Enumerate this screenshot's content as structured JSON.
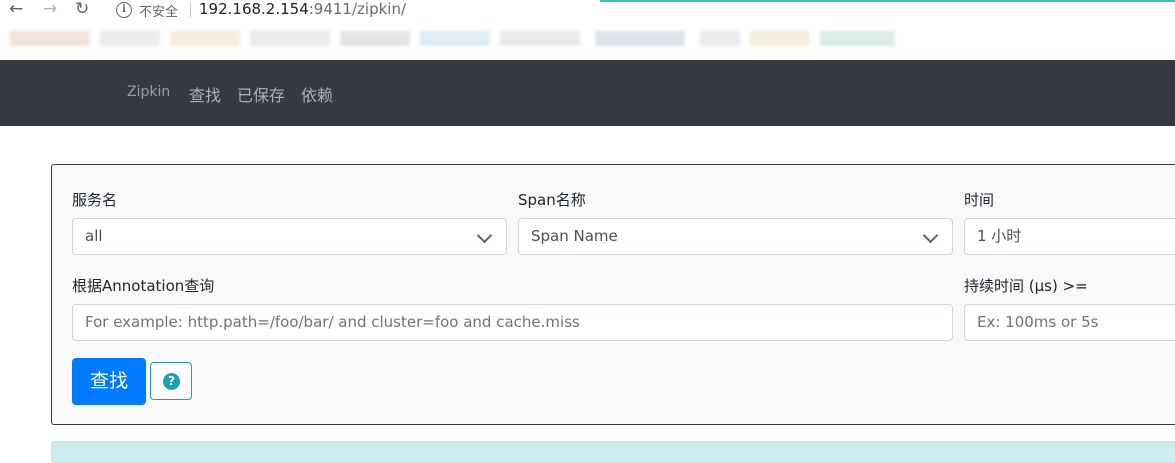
{
  "browser": {
    "security_label": "不安全",
    "url_host": "192.168.2.154",
    "url_path": ":9411/zipkin/"
  },
  "navbar": {
    "brand": "Zipkin",
    "links": [
      "查找",
      "已保存",
      "依赖"
    ]
  },
  "search": {
    "service_label": "服务名",
    "service_value": "all",
    "span_label": "Span名称",
    "span_value": "Span Name",
    "time_label": "时间",
    "time_value": "1 小时",
    "annotation_label": "根据Annotation查询",
    "annotation_placeholder": "For example: http.path=/foo/bar/ and cluster=foo and cache.miss",
    "duration_label": "持续时间 (μs) >=",
    "duration_placeholder": "Ex: 100ms or 5s",
    "search_button": "查找",
    "help_icon": "question-circle-icon"
  },
  "colors": {
    "navbar_bg": "#343a40",
    "primary": "#007bff",
    "info": "#17a2b8"
  }
}
